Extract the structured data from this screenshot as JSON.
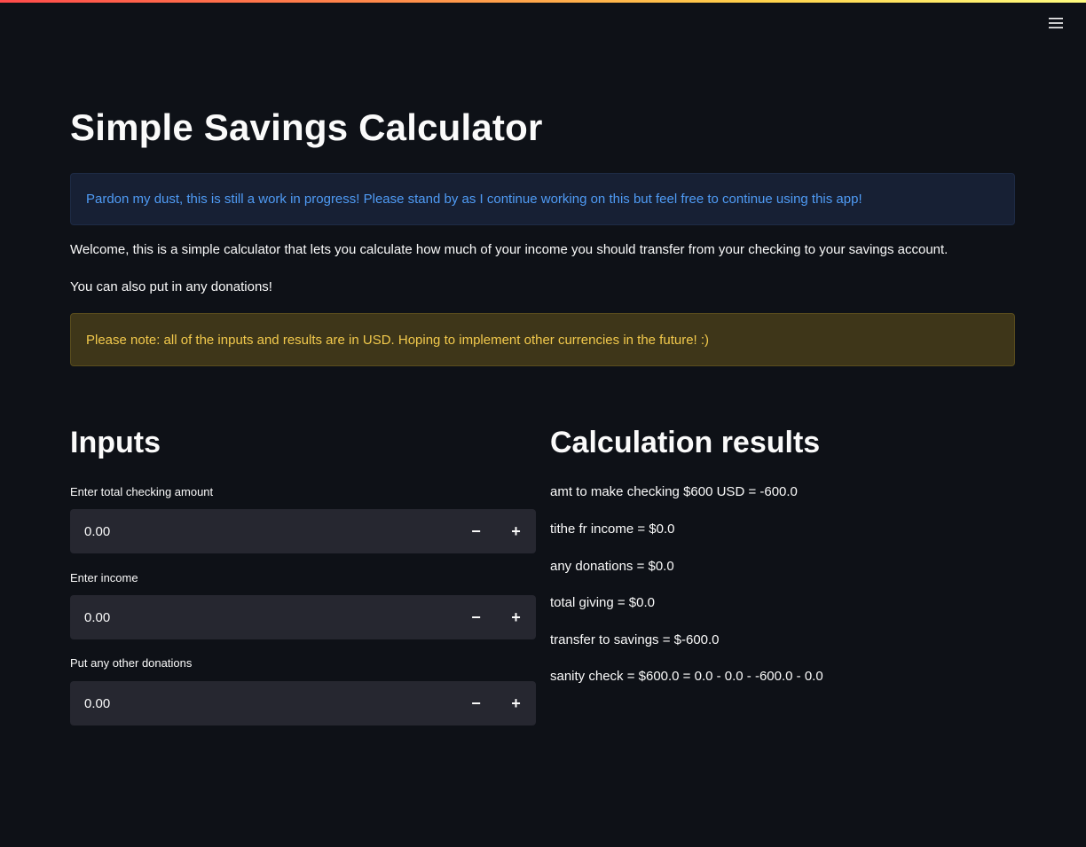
{
  "app": {
    "title": "Simple Savings Calculator"
  },
  "header": {
    "menu_icon": "hamburger-menu-icon"
  },
  "alerts": {
    "info": "Pardon my dust, this is still a work in progress! Please stand by as I continue working on this but feel free to continue using this app!",
    "warning": "Please note: all of the inputs and results are in USD. Hoping to implement other currencies in the future! :)"
  },
  "intro": {
    "welcome": "Welcome, this is a simple calculator that lets you calculate how much of your income you should transfer from your checking to your savings account.",
    "donations": "You can also put in any donations!"
  },
  "inputs": {
    "heading": "Inputs",
    "fields": [
      {
        "label": "Enter total checking amount",
        "value": "0.00",
        "decrement": "−",
        "increment": "+"
      },
      {
        "label": "Enter income",
        "value": "0.00",
        "decrement": "−",
        "increment": "+"
      },
      {
        "label": "Put any other donations",
        "value": "0.00",
        "decrement": "−",
        "increment": "+"
      }
    ]
  },
  "results": {
    "heading": "Calculation results",
    "lines": [
      "amt to make checking $600 USD = -600.0",
      "tithe fr income = $0.0",
      "any donations = $0.0",
      "total giving = $0.0",
      "transfer to savings = $-600.0",
      "sanity check = $600.0 = 0.0 - 0.0 - -600.0 - 0.0"
    ]
  },
  "colors": {
    "background": "#0e1117",
    "info_text": "#4f9bf5",
    "warning_text": "#f2c94c",
    "input_bg": "#262730"
  }
}
